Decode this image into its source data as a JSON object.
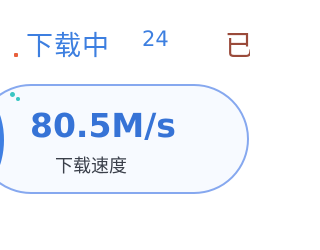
{
  "tabs": {
    "active": {
      "label": "下载中",
      "count": "24"
    },
    "next": {
      "label": "已"
    }
  },
  "speed_card": {
    "value": "80.5M/s",
    "label": "下载速度",
    "gauge_icon": "speed-gauge-icon"
  },
  "colors": {
    "accent": "#3d7fe0",
    "card_border": "#86a8ef",
    "gauge_fill": "#3f7fe2",
    "gauge_tick": "#39c6c3"
  }
}
